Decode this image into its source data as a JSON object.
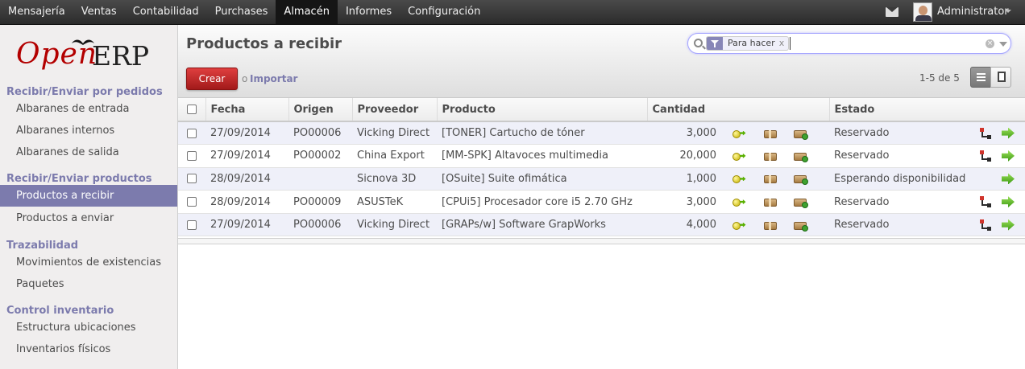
{
  "topbar": {
    "menu": [
      {
        "label": "Mensajería",
        "active": false
      },
      {
        "label": "Ventas",
        "active": false
      },
      {
        "label": "Contabilidad",
        "active": false
      },
      {
        "label": "Purchases",
        "active": false
      },
      {
        "label": "Almacén",
        "active": true
      },
      {
        "label": "Informes",
        "active": false
      },
      {
        "label": "Configuración",
        "active": false
      }
    ],
    "user": "Administrator",
    "icons": [
      "mail-icon",
      "avatar",
      "chevron-down-icon"
    ]
  },
  "sidebar": {
    "logo": {
      "part1": "Open",
      "part2": "ERP"
    },
    "sections": [
      {
        "title": "Recibir/Enviar por pedidos",
        "items": [
          "Albaranes de entrada",
          "Albaranes internos",
          "Albaranes de salida"
        ]
      },
      {
        "title": "Recibir/Enviar productos",
        "items": [
          "Productos a recibir",
          "Productos a enviar"
        ]
      },
      {
        "title": "Trazabilidad",
        "items": [
          "Movimientos de existencias",
          "Paquetes"
        ]
      },
      {
        "title": "Control inventario",
        "items": [
          "Estructura ubicaciones",
          "Inventarios físicos"
        ]
      }
    ],
    "active_item": "Productos a recibir"
  },
  "header": {
    "title": "Productos a recibir",
    "search": {
      "facet_label": "Para hacer",
      "facet_close": "x",
      "value": "",
      "placeholder": ""
    },
    "create_label": "Crear",
    "or_label": "o",
    "import_label": "Importar",
    "pager": "1-5 de 5"
  },
  "table": {
    "columns": [
      "Fecha",
      "Origen",
      "Proveedor",
      "Producto",
      "Cantidad",
      "Estado"
    ],
    "rows": [
      {
        "fecha": "27/09/2014",
        "origen": "PO00006",
        "proveedor": "Vicking Direct",
        "producto": "[TONER] Cartucho de tóner",
        "cantidad": "3,000",
        "estado": "Reservado",
        "split": true
      },
      {
        "fecha": "27/09/2014",
        "origen": "PO00002",
        "proveedor": "China Export",
        "producto": "[MM-SPK] Altavoces multimedia",
        "cantidad": "20,000",
        "estado": "Reservado",
        "split": true
      },
      {
        "fecha": "28/09/2014",
        "origen": "",
        "proveedor": "Sicnova 3D",
        "producto": "[OSuite] Suite ofimática",
        "cantidad": "1,000",
        "estado": "Esperando disponibilidad",
        "split": false
      },
      {
        "fecha": "28/09/2014",
        "origen": "PO00009",
        "proveedor": "ASUSTeK",
        "producto": "[CPUi5] Procesador core i5 2.70 GHz",
        "cantidad": "3,000",
        "estado": "Reservado",
        "split": true
      },
      {
        "fecha": "27/09/2014",
        "origen": "PO00006",
        "proveedor": "Vicking Direct",
        "producto": "[GRAPs/w] Software GrapWorks",
        "cantidad": "4,000",
        "estado": "Reservado",
        "split": true
      }
    ],
    "row_icons": [
      "move-icon",
      "box-icon",
      "pack-icon",
      "split-icon",
      "process-arrow-icon"
    ]
  },
  "colors": {
    "brand": "#7c7bad",
    "create": "#c92a2a",
    "topbar": "#3a3a3a"
  }
}
